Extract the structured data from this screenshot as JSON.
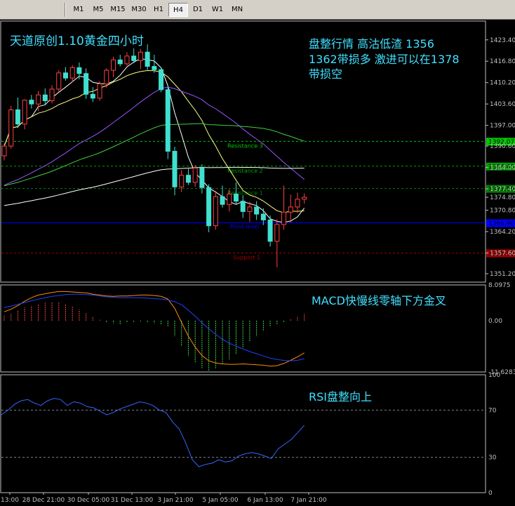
{
  "toolbar": {
    "timeframes": [
      "M1",
      "M5",
      "M15",
      "M30",
      "H1",
      "H4",
      "D1",
      "W1",
      "MN"
    ],
    "active": "H4"
  },
  "chart_data": [
    {
      "panel": "price",
      "type": "candlestick",
      "annotation_main": "天道原创1.10黄金四小时",
      "annotation_side": [
        "盘整行情 高沽低渣 1356",
        "1362带损多 激进可以在1378",
        "带损空"
      ],
      "y_ticks": [
        "1423.40",
        "1416.80",
        "1410.20",
        "1403.60",
        "1397.00",
        "1390.60",
        "1384.00",
        "1377.40",
        "1374.80",
        "1370.80",
        "1364.20",
        "1357.60",
        "1351.20"
      ],
      "ylim": [
        1348.6,
        1429.2
      ],
      "current_price": "1374.80",
      "candles": [
        [
          1387.6,
          1391.4,
          1386.2,
          1390.6
        ],
        [
          1390.6,
          1403.0,
          1389.8,
          1401.8
        ],
        [
          1401.8,
          1405.6,
          1396.2,
          1397.4
        ],
        [
          1397.4,
          1405.0,
          1395.8,
          1404.8
        ],
        [
          1404.8,
          1406.4,
          1402.2,
          1403.6
        ],
        [
          1403.6,
          1407.6,
          1401.4,
          1406.4
        ],
        [
          1406.4,
          1408.4,
          1403.2,
          1404.6
        ],
        [
          1404.6,
          1409.4,
          1403.8,
          1408.2
        ],
        [
          1408.2,
          1414.0,
          1407.4,
          1413.2
        ],
        [
          1413.2,
          1415.0,
          1410.8,
          1411.6
        ],
        [
          1411.6,
          1415.6,
          1410.4,
          1414.8
        ],
        [
          1414.8,
          1416.4,
          1411.2,
          1413.0
        ],
        [
          1413.0,
          1414.6,
          1405.2,
          1406.6
        ],
        [
          1406.6,
          1408.8,
          1404.2,
          1405.4
        ],
        [
          1405.4,
          1410.6,
          1404.6,
          1409.8
        ],
        [
          1409.8,
          1414.6,
          1408.6,
          1414.0
        ],
        [
          1414.0,
          1418.2,
          1411.8,
          1417.2
        ],
        [
          1417.2,
          1418.8,
          1415.2,
          1416.0
        ],
        [
          1416.0,
          1419.6,
          1415.4,
          1418.4
        ],
        [
          1418.4,
          1420.8,
          1416.2,
          1417.0
        ],
        [
          1417.0,
          1420.6,
          1414.4,
          1419.6
        ],
        [
          1419.6,
          1422.0,
          1413.8,
          1415.2
        ],
        [
          1415.2,
          1418.8,
          1413.2,
          1414.2
        ],
        [
          1414.2,
          1414.8,
          1407.2,
          1408.0
        ],
        [
          1408.0,
          1409.4,
          1386.6,
          1389.0
        ],
        [
          1389.0,
          1390.4,
          1375.4,
          1378.0
        ],
        [
          1378.0,
          1383.2,
          1376.4,
          1381.6
        ],
        [
          1381.6,
          1383.6,
          1378.6,
          1379.4
        ],
        [
          1379.4,
          1384.8,
          1378.0,
          1383.8
        ],
        [
          1383.8,
          1385.0,
          1376.0,
          1377.8
        ],
        [
          1377.8,
          1378.8,
          1364.0,
          1366.0
        ],
        [
          1366.0,
          1376.8,
          1364.8,
          1375.0
        ],
        [
          1375.0,
          1378.4,
          1371.6,
          1372.6
        ],
        [
          1372.6,
          1377.2,
          1370.4,
          1375.8
        ],
        [
          1375.8,
          1379.4,
          1372.8,
          1373.6
        ],
        [
          1373.6,
          1375.4,
          1368.4,
          1370.4
        ],
        [
          1370.4,
          1373.4,
          1367.2,
          1371.8
        ],
        [
          1371.8,
          1373.6,
          1367.8,
          1369.6
        ],
        [
          1369.6,
          1371.4,
          1366.2,
          1367.8
        ],
        [
          1367.8,
          1369.2,
          1359.6,
          1361.2
        ],
        [
          1361.2,
          1368.0,
          1353.2,
          1366.4
        ],
        [
          1366.4,
          1378.4,
          1364.8,
          1370.2
        ],
        [
          1370.2,
          1375.6,
          1367.0,
          1371.8
        ],
        [
          1371.8,
          1376.2,
          1370.0,
          1374.2
        ],
        [
          1374.2,
          1376.0,
          1372.8,
          1374.8
        ]
      ],
      "levels": [
        {
          "label": "Resistance 3",
          "value": 1392.07,
          "price_tag": "1392.07",
          "color": "#00c800"
        },
        {
          "label": "Resistance 2",
          "value": 1384.4,
          "price_tag": "1384.40",
          "color": "#00a000"
        },
        {
          "label": "Resistance 1",
          "value": 1377.5,
          "price_tag": "1377.50",
          "color": "#008000"
        },
        {
          "label": "Pivot level",
          "value": 1366.9,
          "price_tag": "1366.90",
          "color": "#0000ff"
        },
        {
          "label": "Support 1",
          "value": 1357.6,
          "price_tag": "1358.50",
          "color": "#a00000"
        }
      ]
    },
    {
      "panel": "macd",
      "type": "bar",
      "annotation": "MACD快慢线零轴下方金叉",
      "y_ticks": [
        "8.0975",
        "0.00",
        "-11.6283"
      ],
      "ylim": [
        -11.6283,
        8.0975
      ],
      "histogram": [
        1.2,
        1.6,
        2.4,
        3.0,
        3.4,
        3.8,
        4.1,
        4.3,
        4.2,
        3.8,
        3.2,
        2.5,
        1.7,
        0.8,
        0.2,
        -0.4,
        -0.6,
        -0.8,
        -0.5,
        -0.3,
        -0.2,
        -0.4,
        -0.6,
        -0.8,
        -1.4,
        -3.5,
        -5.8,
        -7.9,
        -9.6,
        -10.8,
        -11.3,
        -10.9,
        -10.0,
        -8.8,
        -7.5,
        -6.2,
        -4.8,
        -3.5,
        -2.3,
        -1.4,
        -0.8,
        -0.3,
        0.3,
        1.0,
        1.6
      ],
      "macd_line": [
        2.0,
        2.6,
        3.4,
        4.4,
        5.2,
        5.8,
        6.1,
        6.4,
        6.6,
        6.6,
        6.5,
        6.4,
        6.3,
        6.0,
        5.8,
        5.6,
        5.5,
        5.6,
        5.6,
        5.7,
        5.8,
        5.8,
        5.7,
        5.5,
        4.9,
        2.8,
        -0.4,
        -3.5,
        -6.0,
        -7.9,
        -9.1,
        -9.6,
        -9.8,
        -9.9,
        -9.9,
        -9.8,
        -9.9,
        -10.0,
        -10.1,
        -10.3,
        -10.2,
        -9.7,
        -9.0,
        -8.2,
        -7.3
      ],
      "signal_line": [
        3.0,
        3.3,
        3.7,
        4.1,
        4.5,
        4.9,
        5.2,
        5.5,
        5.7,
        5.9,
        6.0,
        6.0,
        5.9,
        5.8,
        5.6,
        5.4,
        5.3,
        5.2,
        5.2,
        5.2,
        5.2,
        5.1,
        5.0,
        4.9,
        4.7,
        4.3,
        3.6,
        2.4,
        1.0,
        -0.5,
        -1.9,
        -3.1,
        -4.2,
        -5.1,
        -5.8,
        -6.4,
        -7.0,
        -7.5,
        -8.0,
        -8.5,
        -8.8,
        -9.0,
        -9.1,
        -9.0,
        -8.6
      ]
    },
    {
      "panel": "rsi",
      "type": "line",
      "annotation": "RSI盘整向上",
      "y_ticks": [
        "100",
        "70",
        "30",
        "0"
      ],
      "ylim": [
        0,
        100
      ],
      "levels": [
        70,
        30
      ],
      "values": [
        66,
        70,
        75,
        78,
        79,
        76,
        74,
        78,
        80,
        79,
        74,
        77,
        76,
        73,
        72,
        69,
        66,
        68,
        71,
        73,
        75,
        77,
        76,
        74,
        70,
        68,
        60,
        54,
        42,
        28,
        22,
        24,
        25,
        28,
        26,
        27,
        31,
        33,
        34,
        33,
        31,
        29,
        37,
        41,
        45,
        51,
        57
      ]
    }
  ],
  "x_ticks": [
    "13:00",
    "28 Dec 21:00",
    "30 Dec 05:00",
    "31 Dec 13:00",
    "3 Jan 21:00",
    "5 Jan 05:00",
    "6 Jan 13:00",
    "7 Jan 21:00"
  ],
  "colors": {
    "background": "#000000",
    "bull_candle": "#000000",
    "bear_candle": "#40e0d0",
    "candle_outline_up": "#ff4040",
    "ma_fast": "#ffffff",
    "ma_yellow": "#ffff80",
    "ma_purple": "#9955ff",
    "ma_green": "#40d040",
    "ma_white_slow": "#ffffff",
    "annotation": "#40e0ff",
    "macd_pos": "#ff4040",
    "macd_neg": "#40d040",
    "rsi": "#3366ff"
  }
}
